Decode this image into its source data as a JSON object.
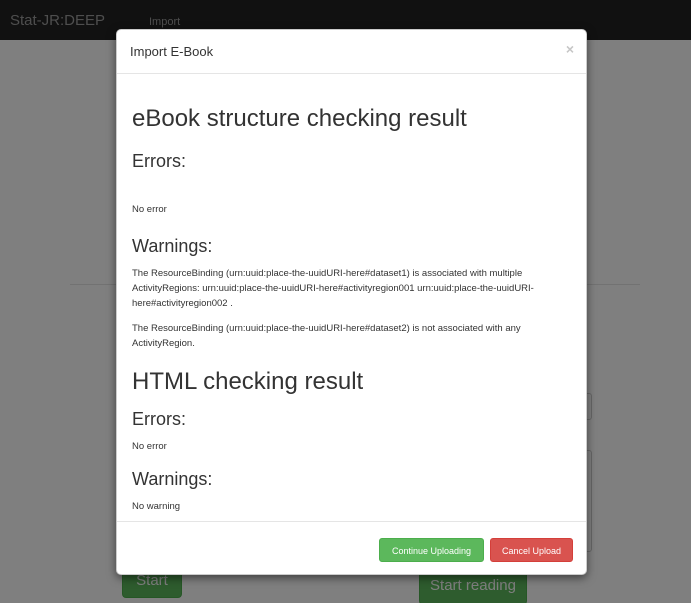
{
  "navbar": {
    "brand": "Stat-JR:DEEP",
    "import_link": "Import"
  },
  "background": {
    "start_button": "Start",
    "start_reading_button": "Start reading"
  },
  "modal": {
    "title": "Import E-Book",
    "close_symbol": "×",
    "ebook_section": {
      "heading": "eBook structure checking result",
      "errors_heading": "Errors:",
      "errors_text": "No error",
      "warnings_heading": "Warnings:",
      "warnings": [
        "The ResourceBinding (urn:uuid:place-the-uuidURI-here#dataset1) is associated with multiple ActivityRegions: urn:uuid:place-the-uuidURI-here#activityregion001 urn:uuid:place-the-uuidURI-here#activityregion002 .",
        "The ResourceBinding (urn:uuid:place-the-uuidURI-here#dataset2) is not associated with any ActivityRegion."
      ]
    },
    "html_section": {
      "heading": "HTML checking result",
      "errors_heading": "Errors:",
      "errors_text": "No error",
      "warnings_heading": "Warnings:",
      "warnings_text": "No warning"
    },
    "footer": {
      "continue_label": "Continue Uploading",
      "cancel_label": "Cancel Upload"
    }
  },
  "colors": {
    "navbar": "#222222",
    "success": "#5cb85c",
    "danger": "#d9534f"
  }
}
